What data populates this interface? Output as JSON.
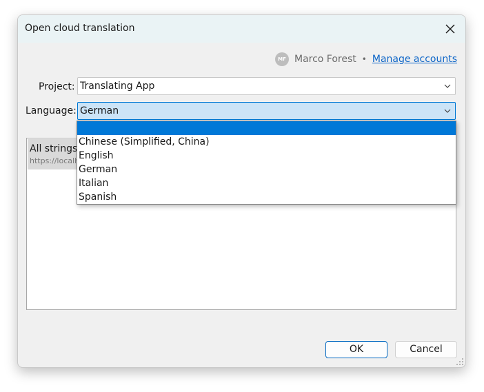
{
  "window": {
    "title": "Open cloud translation",
    "close_glyph": "close-icon"
  },
  "account": {
    "initials": "MF",
    "user_name": "Marco Forest",
    "separator": "•",
    "manage_label": "Manage accounts"
  },
  "project": {
    "label": "Project:",
    "value": "Translating App"
  },
  "language": {
    "label": "Language:",
    "value": "German",
    "options": [
      "",
      "Chinese (Simplified, China)",
      "English",
      "German",
      "Italian",
      "Spanish"
    ],
    "highlighted_index": 0
  },
  "list": {
    "items": [
      {
        "title": "All strings",
        "url": "https://localh"
      }
    ]
  },
  "buttons": {
    "ok_label": "OK",
    "cancel_label": "Cancel"
  },
  "colors": {
    "accent": "#0078d7",
    "link": "#0b64c7",
    "focus_fill": "#cce4f7"
  }
}
